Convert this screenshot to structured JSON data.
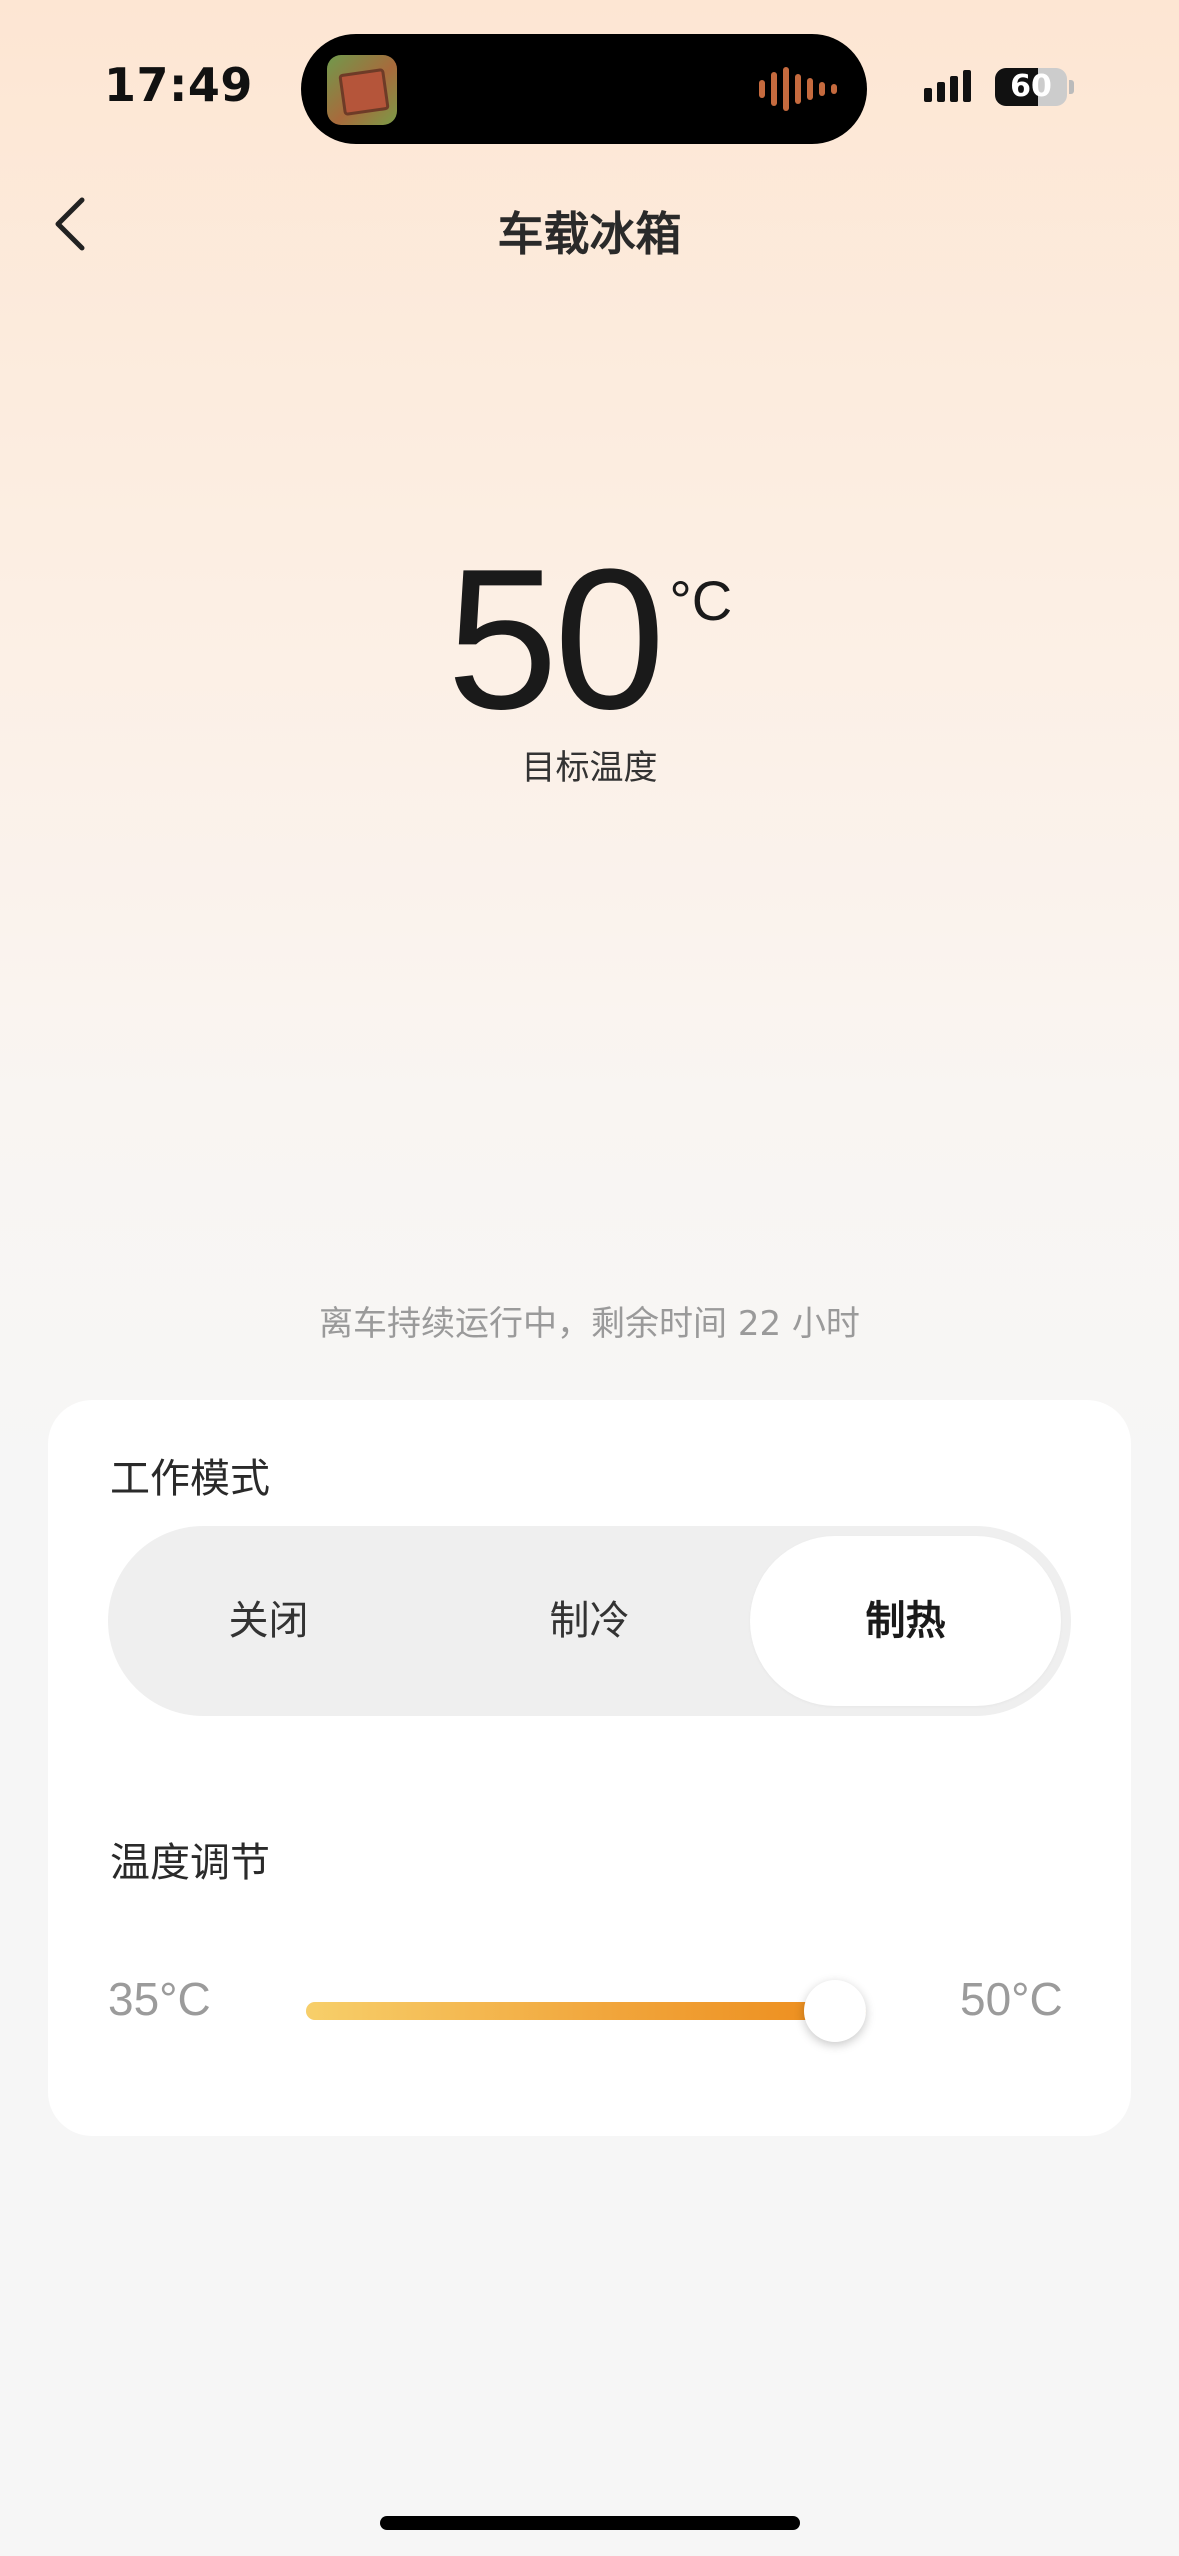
{
  "status_bar": {
    "time": "17:49",
    "battery_level": "60",
    "battery_percent": 60
  },
  "nav": {
    "title": "车载冰箱",
    "back_icon": "chevron-left-icon"
  },
  "temperature": {
    "value": "50",
    "unit": "°C",
    "label": "目标温度"
  },
  "remaining_text": "离车持续运行中，剩余时间 22 小时",
  "card": {
    "mode_title": "工作模式",
    "modes": [
      "关闭",
      "制冷",
      "制热"
    ],
    "selected_mode": "制热",
    "temp_title": "温度调节",
    "range_min": "35°C",
    "range_max": "50°C",
    "slider_value_fraction": 1.0
  },
  "colors": {
    "accent_start": "#f7cf6a",
    "accent_end": "#ec8a19",
    "background_top": "#fde6d3"
  }
}
